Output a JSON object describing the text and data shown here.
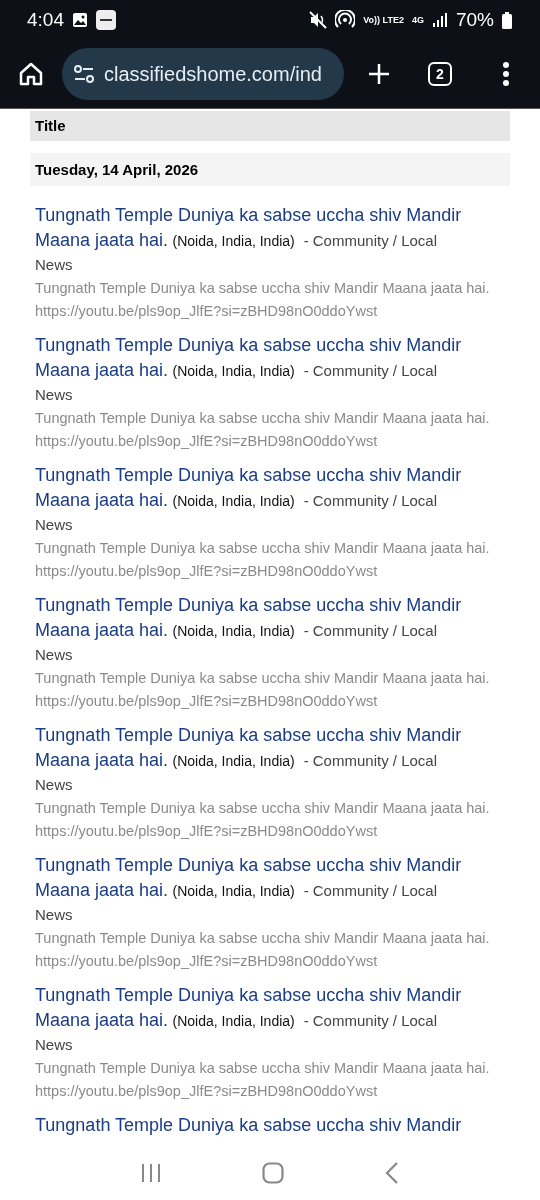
{
  "status_bar": {
    "time": "4:04",
    "network": "4G",
    "sim": "Vo)) LTE2",
    "battery": "70%"
  },
  "browser": {
    "url": "classifiedshome.com/ind",
    "tab_count": "2"
  },
  "table": {
    "header": "Title",
    "date": "Tuesday, 14 April, 2026"
  },
  "listings": [
    {
      "title": "Tungnath Temple Duniya ka sabse uccha shiv Mandir Maana jaata hai.",
      "location": "(Noida, India, India)",
      "category": "- Community / Local News",
      "description": "Tungnath Temple Duniya ka sabse uccha shiv Mandir Maana jaata hai. https://youtu.be/pls9op_JlfE?si=zBHD98nO0ddoYwst"
    },
    {
      "title": "Tungnath Temple Duniya ka sabse uccha shiv Mandir Maana jaata hai.",
      "location": "(Noida, India, India)",
      "category": "- Community / Local News",
      "description": "Tungnath Temple Duniya ka sabse uccha shiv Mandir Maana jaata hai. https://youtu.be/pls9op_JlfE?si=zBHD98nO0ddoYwst"
    },
    {
      "title": "Tungnath Temple Duniya ka sabse uccha shiv Mandir Maana jaata hai.",
      "location": "(Noida, India, India)",
      "category": "- Community / Local News",
      "description": "Tungnath Temple Duniya ka sabse uccha shiv Mandir Maana jaata hai. https://youtu.be/pls9op_JlfE?si=zBHD98nO0ddoYwst"
    },
    {
      "title": "Tungnath Temple Duniya ka sabse uccha shiv Mandir Maana jaata hai.",
      "location": "(Noida, India, India)",
      "category": "- Community / Local News",
      "description": "Tungnath Temple Duniya ka sabse uccha shiv Mandir Maana jaata hai. https://youtu.be/pls9op_JlfE?si=zBHD98nO0ddoYwst"
    },
    {
      "title": "Tungnath Temple Duniya ka sabse uccha shiv Mandir Maana jaata hai.",
      "location": "(Noida, India, India)",
      "category": "- Community / Local News",
      "description": "Tungnath Temple Duniya ka sabse uccha shiv Mandir Maana jaata hai. https://youtu.be/pls9op_JlfE?si=zBHD98nO0ddoYwst"
    },
    {
      "title": "Tungnath Temple Duniya ka sabse uccha shiv Mandir Maana jaata hai.",
      "location": "(Noida, India, India)",
      "category": "- Community / Local News",
      "description": "Tungnath Temple Duniya ka sabse uccha shiv Mandir Maana jaata hai. https://youtu.be/pls9op_JlfE?si=zBHD98nO0ddoYwst"
    },
    {
      "title": "Tungnath Temple Duniya ka sabse uccha shiv Mandir Maana jaata hai.",
      "location": "(Noida, India, India)",
      "category": "- Community / Local News",
      "description": "Tungnath Temple Duniya ka sabse uccha shiv Mandir Maana jaata hai. https://youtu.be/pls9op_JlfE?si=zBHD98nO0ddoYwst"
    },
    {
      "title": "Tungnath Temple Duniya ka sabse uccha shiv Mandir"
    }
  ]
}
